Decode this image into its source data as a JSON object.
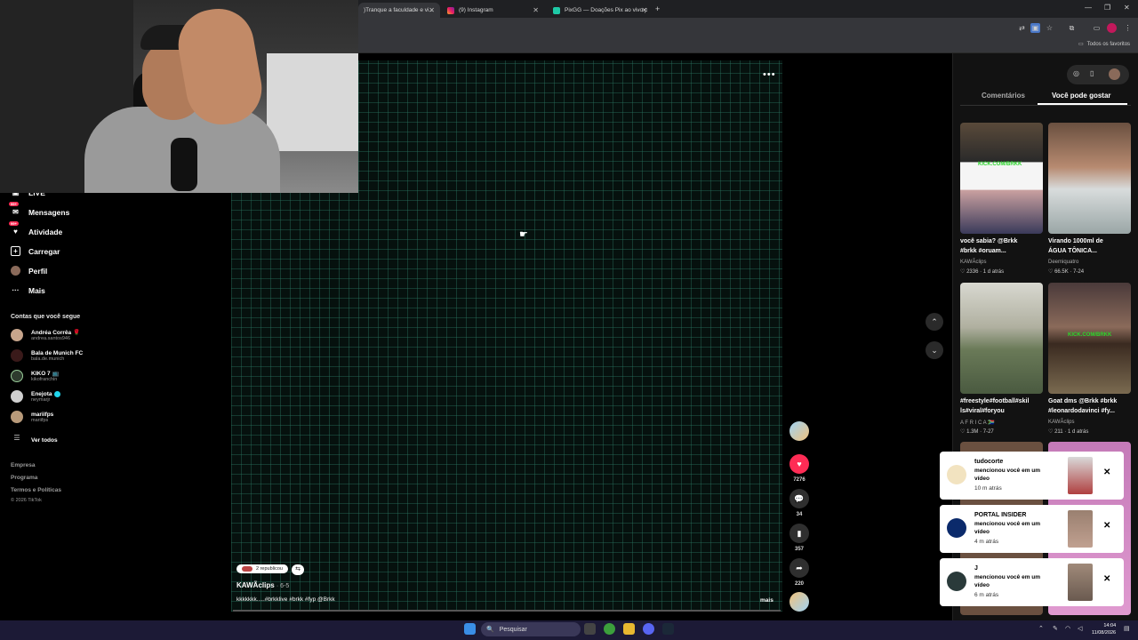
{
  "browser": {
    "tabs": [
      {
        "title": ")Tranque a faculdade e vi...",
        "active": true
      },
      {
        "title": "(9) Instagram",
        "active": false
      },
      {
        "title": "PixGG — Doações Pix ao vivo p",
        "active": false
      }
    ],
    "new_tab": "+",
    "bookmarks_label": "Todos os favoritos"
  },
  "sidebar": {
    "nav": [
      {
        "label": "LIVE",
        "icon": "live-icon"
      },
      {
        "label": "Mensagens",
        "icon": "messages-icon",
        "badge": "99+"
      },
      {
        "label": "Atividade",
        "icon": "activity-icon",
        "badge": "99+"
      },
      {
        "label": "Carregar",
        "icon": "upload-icon"
      },
      {
        "label": "Perfil",
        "icon": "profile-icon"
      },
      {
        "label": "Mais",
        "icon": "more-icon"
      }
    ],
    "following_title": "Contas que você segue",
    "following": [
      {
        "name": "Andréa Corrêa 🌹",
        "handle": "andrea.santos946"
      },
      {
        "name": "Bala de Munich FC",
        "handle": "bala.de.munich"
      },
      {
        "name": "KIKO 7 📺",
        "handle": "kikofranchin"
      },
      {
        "name": "Enejota",
        "handle": "neymarjr",
        "verified": true
      },
      {
        "name": "mariifps",
        "handle": "mariifps"
      }
    ],
    "see_all": "Ver todos",
    "footer": [
      "Empresa",
      "Programa",
      "Termos e Políticas",
      "© 2026 TikTok"
    ]
  },
  "video": {
    "republished": "2 republicou",
    "author": "KAWÃclips",
    "date": "· 6-5",
    "caption": "kkkkkkk.....#brkklive #brkk #fyp @Brkk",
    "more": "mais",
    "more_options": "•••",
    "likes": "7276",
    "comments": "34",
    "saves": "357",
    "shares": "220"
  },
  "right_panel": {
    "tabs": [
      "Comentários",
      "Você pode gostar"
    ],
    "active_tab": "Você pode gostar",
    "cards": [
      {
        "desc1": "você sabia? @Brkk",
        "desc2": "#brkk #oruam...",
        "author": "KAWÃclips",
        "likes": "2336",
        "age": "1 d atrás"
      },
      {
        "desc1": "Virando 1000ml de",
        "desc2": "ÁGUA TÔNICA...",
        "author": "Deemiquatro",
        "likes": "66.5K",
        "age": "7-24"
      },
      {
        "desc1": "#freestyle#football#skil",
        "desc2": "ls#viral#foryou",
        "author": "A F R I C A 🇿🇦",
        "likes": "1.3M",
        "age": "7-27"
      },
      {
        "desc1": "Goat dms @Brkk #brkk",
        "desc2": "#leonardodavinci #fy...",
        "author": "KAWÃclips",
        "likes": "211",
        "age": "1 d atrás"
      }
    ]
  },
  "notifications": [
    {
      "name": "tudocorte",
      "text": "mencionou você em um vídeo",
      "time": "10 m atrás"
    },
    {
      "name": "PORTAL INSIDER",
      "text": "mencionou você em um vídeo",
      "time": "4 m atrás"
    },
    {
      "name": "J",
      "text": "mencionou você em um vídeo",
      "time": "6 m atrás"
    }
  ],
  "taskbar": {
    "search": "Pesquisar",
    "time": "14:04",
    "date": "11/08/2026"
  },
  "colors": {
    "accent": "#fe2c55",
    "taskbar": "#1c1a36"
  }
}
